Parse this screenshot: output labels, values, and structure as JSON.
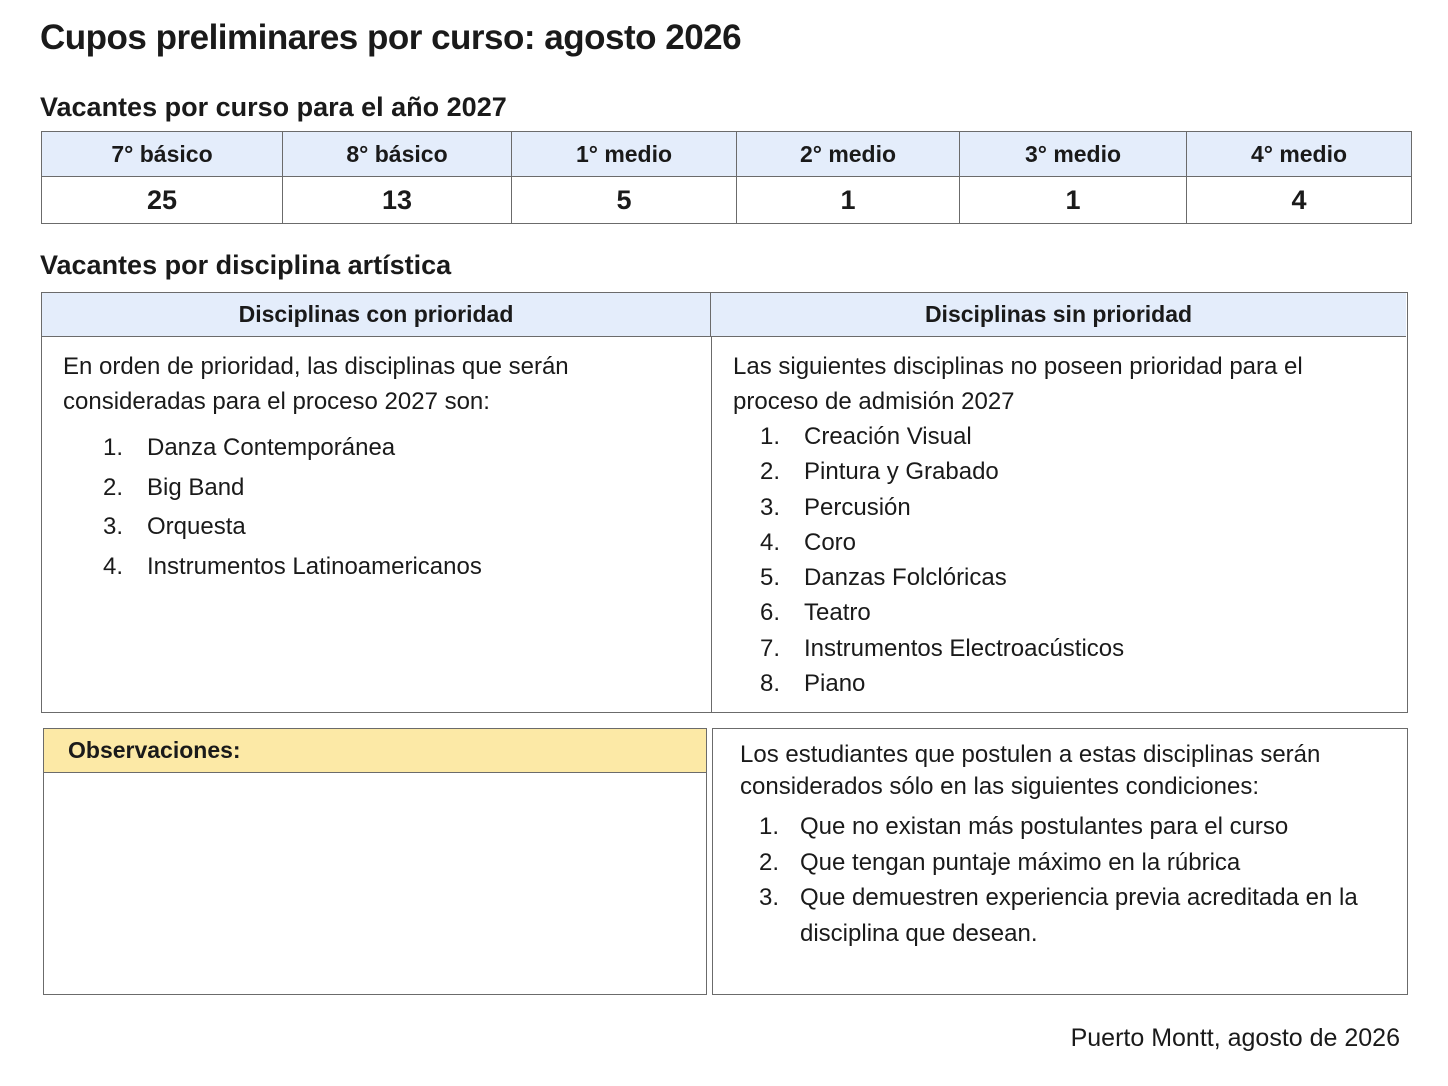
{
  "title": "Cupos preliminares por curso: agosto 2026",
  "courses_section": {
    "title": "Vacantes por curso para el año 2027",
    "headers": [
      "7° básico",
      "8° básico",
      "1° medio",
      "2° medio",
      "3° medio",
      "4° medio"
    ],
    "values": [
      "25",
      "13",
      "5",
      "1",
      "1",
      "4"
    ]
  },
  "disciplines_section": {
    "title": "Vacantes por disciplina artística",
    "priority": {
      "header": "Disciplinas con prioridad",
      "intro": "En orden de prioridad, las disciplinas que serán consideradas para el proceso 2027 son:",
      "items": [
        {
          "num": "1.",
          "text": "Danza Contemporánea"
        },
        {
          "num": "2.",
          "text": "Big Band"
        },
        {
          "num": "3.",
          "text": "Orquesta"
        },
        {
          "num": "4.",
          "text": "Instrumentos Latinoamericanos"
        }
      ]
    },
    "no_priority": {
      "header": "Disciplinas sin prioridad",
      "intro": "Las siguientes disciplinas no poseen prioridad para el proceso de admisión 2027",
      "items": [
        {
          "num": "1.",
          "text": "Creación Visual"
        },
        {
          "num": "2.",
          "text": "Pintura y Grabado"
        },
        {
          "num": "3.",
          "text": "Percusión"
        },
        {
          "num": "4.",
          "text": "Coro"
        },
        {
          "num": "5.",
          "text": "Danzas Folclóricas"
        },
        {
          "num": "6.",
          "text": "Teatro"
        },
        {
          "num": "7.",
          "text": "Instrumentos Electroacústicos"
        },
        {
          "num": "8.",
          "text": "Piano"
        }
      ]
    }
  },
  "observations": {
    "header": "Observaciones:"
  },
  "conditions": {
    "intro": "Los estudiantes que postulen a estas disciplinas serán considerados sólo en las siguientes condiciones:",
    "items": [
      {
        "num": "1.",
        "text": "Que no existan más postulantes para el curso"
      },
      {
        "num": "2.",
        "text": "Que tengan puntaje máximo en la rúbrica"
      },
      {
        "num": "3.",
        "text": "Que demuestren experiencia previa acreditada en la disciplina que desean."
      }
    ]
  },
  "footer": "Puerto Montt, agosto de 2026",
  "colors": {
    "header_blue": "#e4edfb",
    "observations_yellow": "#fce9a6",
    "border": "#6b6b6b"
  }
}
